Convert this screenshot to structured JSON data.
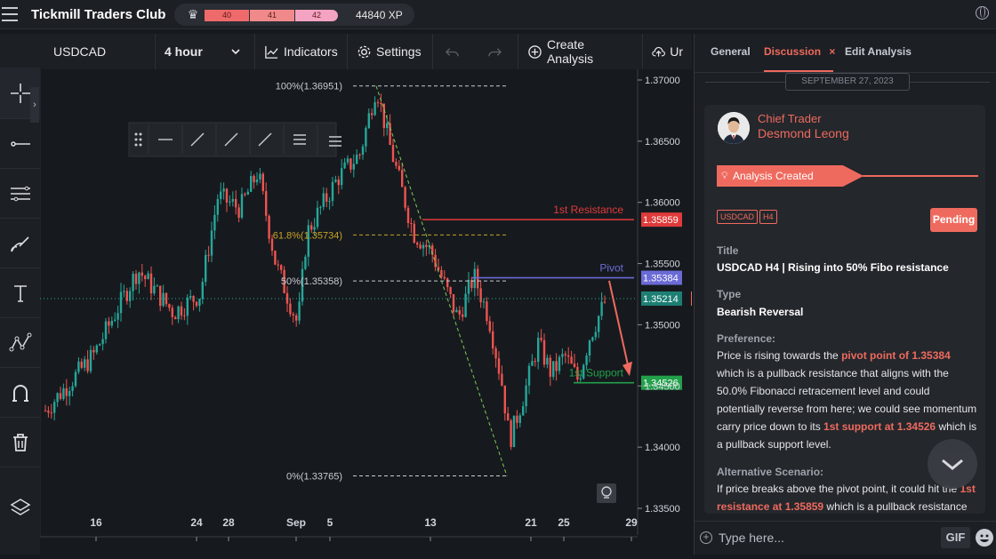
{
  "topbar": {
    "title": "Tickmill Traders Club",
    "xp_bars": [
      "40",
      "41",
      "42"
    ],
    "xp_total": "44840 XP"
  },
  "toolbar": {
    "symbol": "USDCAD",
    "interval": "4 hour",
    "indicators": "Indicators",
    "settings": "Settings",
    "create_analysis": "Create Analysis",
    "upload_partial": "Ur"
  },
  "chart_data": {
    "type": "candlestick",
    "price_axis": [
      "1.37000",
      "1.36500",
      "1.36000",
      "1.35500",
      "1.35000",
      "1.34500",
      "1.34000",
      "1.33500"
    ],
    "ylim": [
      1.335,
      1.37
    ],
    "time_axis": [
      {
        "label": "16"
      },
      {
        "label": "24"
      },
      {
        "label": "28"
      },
      {
        "label": "Sep"
      },
      {
        "label": "5"
      },
      {
        "label": "13"
      },
      {
        "label": "21"
      },
      {
        "label": "25"
      },
      {
        "label": "29"
      }
    ],
    "fib_levels": [
      {
        "label": "100%(1.36951)",
        "price": 1.36951
      },
      {
        "label": "61.8%(1.35734)",
        "price": 1.35734
      },
      {
        "label": "50%(1.35358)",
        "price": 1.35358
      },
      {
        "label": "0%(1.33765)",
        "price": 1.33765
      }
    ],
    "lines": [
      {
        "name": "1st Resistance",
        "price": 1.35859,
        "badge": "1.35859",
        "color": "#e03a3a"
      },
      {
        "name": "Pivot",
        "price": 1.35384,
        "badge": "1.35384",
        "color": "#6b6bd6"
      },
      {
        "name": "1st Support",
        "price": 1.34526,
        "badge": "1.34526",
        "color": "#22a04b"
      }
    ],
    "current_price": {
      "price": 1.35214,
      "badge": "1.35214"
    },
    "colors": {
      "up": "#26a69a",
      "down": "#ef5350",
      "fib": "#c9a227"
    }
  },
  "panel": {
    "tabs": [
      "General",
      "Discussion",
      "Edit Analysis"
    ],
    "close_glyph": "×",
    "date": "SEPTEMBER 27, 2023",
    "author_role": "Chief Trader",
    "author_name": "Desmond Leong",
    "created_label": "Analysis Created",
    "tags": [
      "USDCAD",
      "H4"
    ],
    "status": "Pending",
    "title_label": "Title",
    "title_value": "USDCAD H4 | Rising into 50% Fibo resistance",
    "type_label": "Type",
    "type_value": "Bearish Reversal",
    "preference_label": "Preference:",
    "preference": {
      "t1": "Price is rising towards the ",
      "h1": "pivot point of 1.35384",
      "t2": " which is a pullback resistance that aligns with the 50.0% Fibonacci retracement level and could potentially reverse from here; we could see momentum carry price down to its ",
      "h2": "1st support at 1.34526",
      "t3": " which is a pullback support level."
    },
    "alternative_label": "Alternative Scenario:",
    "alternative": {
      "t1": "If price breaks above the pivot point, it could hit the ",
      "h1": "1st resistance at 1.35859",
      "t2": " which is a pullback resistance"
    },
    "input_placeholder": "Type here...",
    "gif_label": "GIF"
  }
}
